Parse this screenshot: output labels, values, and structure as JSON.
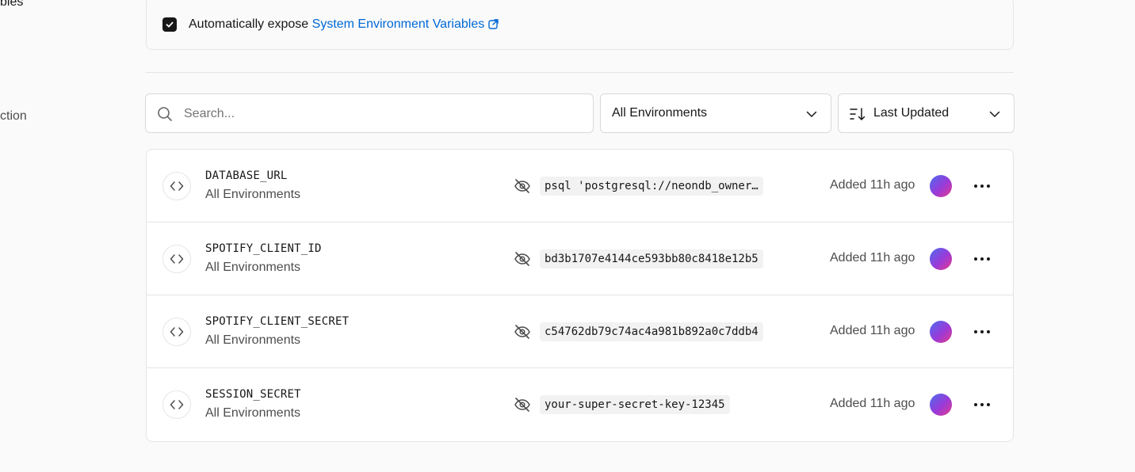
{
  "sidebar": {
    "items": [
      {
        "label": "bles"
      },
      {
        "label": "ction"
      }
    ]
  },
  "expose": {
    "checked": true,
    "text": "Automatically expose",
    "link_text": "System Environment Variables"
  },
  "filters": {
    "search_placeholder": "Search...",
    "environment": "All Environments",
    "sort": "Last Updated"
  },
  "variables": [
    {
      "name": "DATABASE_URL",
      "environment": "All Environments",
      "value": "psql 'postgresql://neondb_owner…",
      "added": "Added 11h ago"
    },
    {
      "name": "SPOTIFY_CLIENT_ID",
      "environment": "All Environments",
      "value": "bd3b1707e4144ce593bb80c8418e12b5",
      "added": "Added 11h ago"
    },
    {
      "name": "SPOTIFY_CLIENT_SECRET",
      "environment": "All Environments",
      "value": "c54762db79c74ac4a981b892a0c7ddb4",
      "added": "Added 11h ago"
    },
    {
      "name": "SESSION_SECRET",
      "environment": "All Environments",
      "value": "your-super-secret-key-12345",
      "added": "Added 11h ago"
    }
  ],
  "colors": {
    "link": "#0068d6",
    "border": "#e5e5e5",
    "muted_text": "#4d4d4d",
    "avatar_gradient": [
      "#4b6cf0",
      "#9b3ad8",
      "#e43a8c"
    ]
  }
}
